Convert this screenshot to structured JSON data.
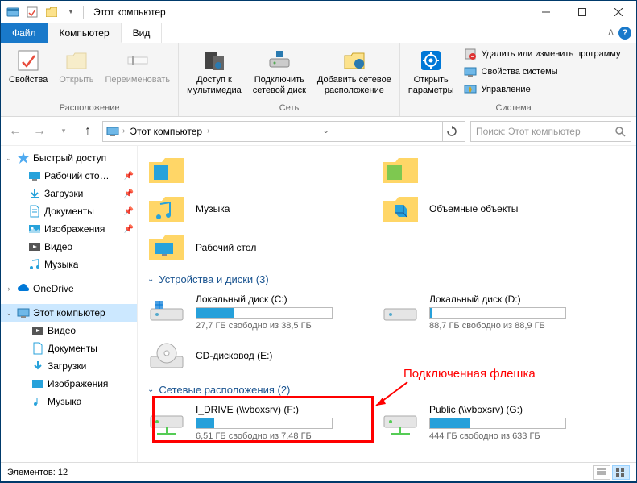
{
  "titlebar": {
    "title": "Этот компьютер"
  },
  "tabs": {
    "file": "Файл",
    "computer": "Компьютер",
    "view": "Вид"
  },
  "ribbon": {
    "group1_label": "Расположение",
    "properties": "Свойства",
    "open": "Открыть",
    "rename": "Переименовать",
    "group2_label": "Сеть",
    "media": "Доступ к\nмультимедиа",
    "map_drive": "Подключить\nсетевой диск",
    "add_network": "Добавить сетевое\nрасположение",
    "group3_label": "Система",
    "open_params": "Открыть\nпараметры",
    "uninstall": "Удалить или изменить программу",
    "sys_properties": "Свойства системы",
    "manage": "Управление"
  },
  "address": {
    "crumb1": "Этот компьютер",
    "search_placeholder": "Поиск: Этот компьютер"
  },
  "sidebar": {
    "quick_access": "Быстрый доступ",
    "desktop": "Рабочий сто…",
    "downloads": "Загрузки",
    "documents": "Документы",
    "pictures": "Изображения",
    "videos": "Видео",
    "music": "Музыка",
    "onedrive": "OneDrive",
    "this_pc": "Этот компьютер",
    "pc_videos": "Видео",
    "pc_documents": "Документы",
    "pc_downloads": "Загрузки",
    "pc_pictures": "Изображения",
    "pc_music": "Музыка"
  },
  "content": {
    "music": "Музыка",
    "objects3d": "Объемные объекты",
    "desktop": "Рабочий стол",
    "section_drives": "Устройства и диски (3)",
    "section_network": "Сетевые расположения (2)",
    "drive_c_name": "Локальный диск (C:)",
    "drive_c_free": "27,7 ГБ свободно из 38,5 ГБ",
    "drive_c_pct": 28,
    "drive_d_name": "Локальный диск (D:)",
    "drive_d_free": "88,7 ГБ свободно из 88,9 ГБ",
    "drive_d_pct": 1,
    "drive_e_name": "CD-дисковод (E:)",
    "net_f_name": "I_DRIVE (\\\\vboxsrv) (F:)",
    "net_f_free": "6,51 ГБ свободно из 7,48 ГБ",
    "net_f_pct": 13,
    "net_g_name": "Public (\\\\vboxsrv) (G:)",
    "net_g_free": "444 ГБ свободно из 633 ГБ",
    "net_g_pct": 30
  },
  "annotation": {
    "text": "Подключенная флешка"
  },
  "statusbar": {
    "items": "Элементов: 12"
  }
}
